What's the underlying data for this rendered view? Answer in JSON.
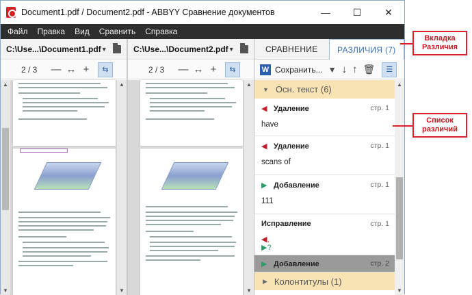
{
  "window": {
    "title": "Document1.pdf / Document2.pdf - ABBYY Сравнение документов",
    "controls": {
      "minimize": "—",
      "maximize": "☐",
      "close": "✕"
    }
  },
  "menu": [
    "Файл",
    "Правка",
    "Вид",
    "Сравнить",
    "Справка"
  ],
  "left_doc": {
    "path": "C:\\Use...\\Document1.pdf",
    "page": "2 / 3"
  },
  "right_doc": {
    "path": "C:\\Use...\\Document2.pdf",
    "page": "2 / 3"
  },
  "tabs": {
    "compare": "СРАВНЕНИЕ",
    "diffs": "РАЗЛИЧИЯ (7)"
  },
  "toolbar": {
    "save_label": "Сохранить..."
  },
  "diff_list": {
    "group_main": "Осн. текст (6)",
    "group_footer": "Колонтитулы (1)",
    "items": [
      {
        "type": "Удаление",
        "page": "стр. 1",
        "text": "have",
        "kind": "del"
      },
      {
        "type": "Удаление",
        "page": "стр. 1",
        "text": "scans of",
        "kind": "del"
      },
      {
        "type": "Добавление",
        "page": "стр. 1",
        "text": "111",
        "kind": "add"
      },
      {
        "type": "Исправление",
        "page": "стр. 1",
        "text": "",
        "kind": "fix"
      },
      {
        "type": "Добавление",
        "page": "стр. 2",
        "text": "",
        "kind": "add"
      }
    ]
  },
  "callouts": {
    "tab": "Вкладка Различия",
    "list": "Список различий"
  },
  "colors": {
    "accent": "#3b72b5",
    "callout": "#e01f2a",
    "group_bg": "#f7e3b4"
  }
}
